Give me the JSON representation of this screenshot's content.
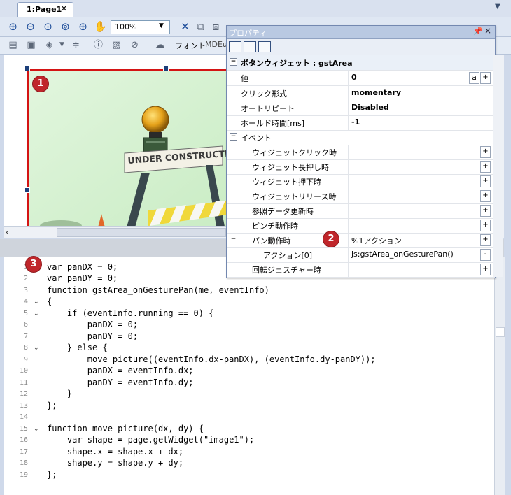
{
  "tab": {
    "label": "1:Page1",
    "close": "×"
  },
  "toolbar": {
    "zoom_value": "100%",
    "font_label": "フォント",
    "md_label": "MDEu"
  },
  "properties": {
    "title": "プロパティ",
    "pin": "ᵖ",
    "close": "×",
    "widget_header": "ボタンウィジェット : gstArea",
    "rows": [
      {
        "name": "値",
        "value": "0"
      },
      {
        "name": "クリック形式",
        "value": "momentary"
      },
      {
        "name": "オートリピート",
        "value": "Disabled"
      },
      {
        "name": "ホールド時間[ms]",
        "value": "-1"
      }
    ],
    "event_header": "イベント",
    "events": [
      {
        "name": "ウィジェットクリック時",
        "value": ""
      },
      {
        "name": "ウィジェット長押し時",
        "value": ""
      },
      {
        "name": "ウィジェット押下時",
        "value": ""
      },
      {
        "name": "ウィジェットリリース時",
        "value": ""
      },
      {
        "name": "参照データ更新時",
        "value": ""
      },
      {
        "name": "ピンチ動作時",
        "value": ""
      },
      {
        "name": "パン動作時",
        "value": "%1アクション"
      },
      {
        "name": "アクション[0]",
        "value": "js:gstArea_onGesturePan()"
      },
      {
        "name": "回転ジェスチャー時",
        "value": ""
      }
    ]
  },
  "canvas": {
    "image_text": "UNDER CONSTRUCTION"
  },
  "markers": [
    "1",
    "2",
    "3"
  ],
  "code": {
    "line_numbers": [
      "1",
      "2",
      "3",
      "4",
      "5",
      "6",
      "7",
      "8",
      "9",
      "10",
      "11",
      "12",
      "13",
      "14",
      "15",
      "16",
      "17",
      "18",
      "19"
    ],
    "lines": [
      "var panDX = 0;",
      "var panDY = 0;",
      "function gstArea_onGesturePan(me, eventInfo)",
      "{",
      "    if (eventInfo.running == 0) {",
      "        panDX = 0;",
      "        panDY = 0;",
      "    } else {",
      "        move_picture((eventInfo.dx-panDX), (eventInfo.dy-panDY));",
      "        panDX = eventInfo.dx;",
      "        panDY = eventInfo.dy;",
      "    }",
      "};",
      "",
      "function move_picture(dx, dy) {",
      "    var shape = page.getWidget(\"image1\");",
      "    shape.x = shape.x + dx;",
      "    shape.y = shape.y + dy;",
      "};"
    ]
  }
}
